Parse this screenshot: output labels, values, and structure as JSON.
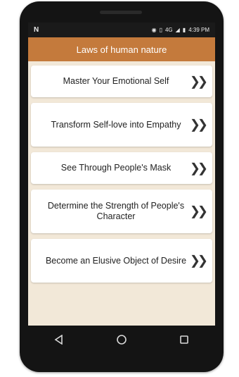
{
  "status_bar": {
    "left_icon": "N",
    "network": "4G",
    "time": "4:39 PM"
  },
  "app_bar": {
    "title": "Laws of human nature"
  },
  "laws": [
    {
      "label": "Master Your Emotional Self"
    },
    {
      "label": "Transform Self-love into Empathy"
    },
    {
      "label": "See Through People's Mask"
    },
    {
      "label": "Determine the Strength of People's Character"
    },
    {
      "label": "Become an Elusive Object of Desire"
    }
  ],
  "icons": {
    "chevron": "double-chevron-right-icon",
    "nav_back": "back-triangle-icon",
    "nav_home": "home-circle-icon",
    "nav_recents": "recents-square-icon"
  },
  "colors": {
    "app_bar": "#c47a3c",
    "background": "#f2e8d8",
    "card": "#ffffff"
  }
}
